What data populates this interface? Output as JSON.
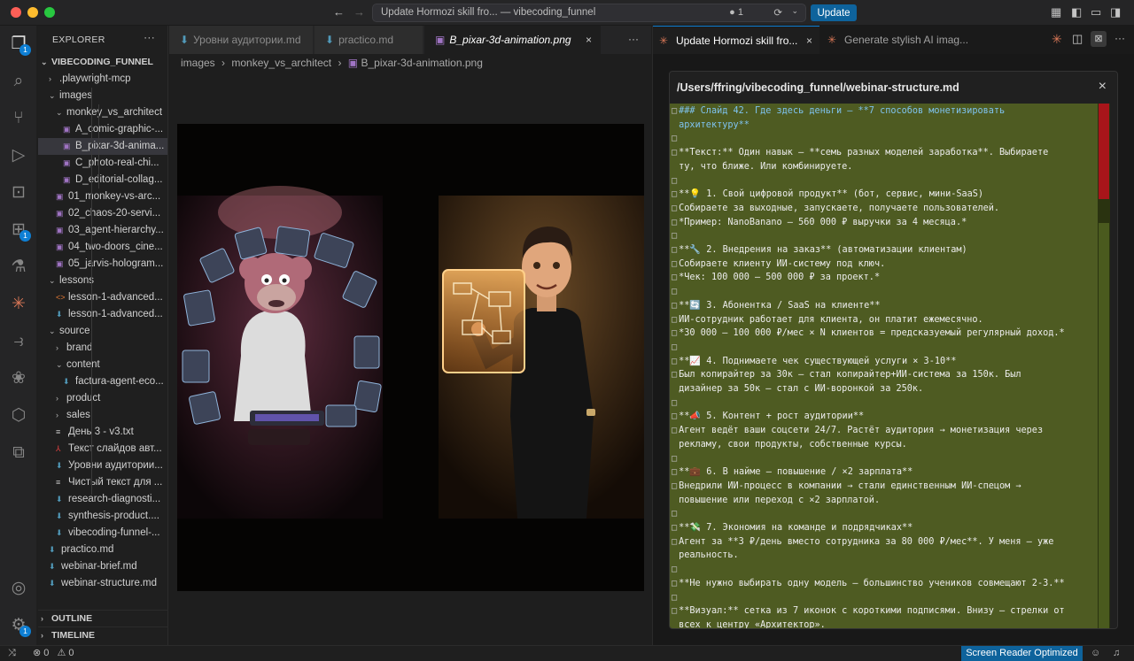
{
  "titlebar": {
    "command_center": "Update Hormozi skill fro... — vibecoding_funnel",
    "notifications_count": "1",
    "update_label": "Update"
  },
  "activity_bar": {
    "explorer_badge": "1",
    "extensions_badge": "1",
    "accounts_badge": "1"
  },
  "explorer": {
    "header": "EXPLORER",
    "project": "VIBECODING_FUNNEL",
    "items": [
      {
        "name": ".playwright-mcp",
        "kind": "folder",
        "open": false,
        "depth": 1
      },
      {
        "name": "images",
        "kind": "folder",
        "open": true,
        "depth": 1
      },
      {
        "name": "monkey_vs_architect",
        "kind": "folder",
        "open": true,
        "depth": 2
      },
      {
        "name": "A_comic-graphic-...",
        "kind": "image",
        "depth": 3
      },
      {
        "name": "B_pixar-3d-anima...",
        "kind": "image",
        "depth": 3,
        "selected": true
      },
      {
        "name": "C_photo-real-chi...",
        "kind": "image",
        "depth": 3
      },
      {
        "name": "D_editorial-collag...",
        "kind": "image",
        "depth": 3
      },
      {
        "name": "01_monkey-vs-arc...",
        "kind": "image",
        "depth": 2
      },
      {
        "name": "02_chaos-20-servi...",
        "kind": "image",
        "depth": 2
      },
      {
        "name": "03_agent-hierarchy...",
        "kind": "image",
        "depth": 2
      },
      {
        "name": "04_two-doors_cine...",
        "kind": "image",
        "depth": 2
      },
      {
        "name": "05_jarvis-hologram...",
        "kind": "image",
        "depth": 2
      },
      {
        "name": "lessons",
        "kind": "folder",
        "open": true,
        "depth": 1
      },
      {
        "name": "lesson-1-advanced...",
        "kind": "html",
        "depth": 2
      },
      {
        "name": "lesson-1-advanced...",
        "kind": "md",
        "depth": 2
      },
      {
        "name": "source",
        "kind": "folder",
        "open": true,
        "depth": 1
      },
      {
        "name": "brand",
        "kind": "folder",
        "open": false,
        "depth": 2
      },
      {
        "name": "content",
        "kind": "folder",
        "open": true,
        "depth": 2
      },
      {
        "name": "factura-agent-eco...",
        "kind": "md",
        "depth": 3
      },
      {
        "name": "product",
        "kind": "folder",
        "open": false,
        "depth": 2
      },
      {
        "name": "sales",
        "kind": "folder",
        "open": false,
        "depth": 2
      },
      {
        "name": "День 3 - v3.txt",
        "kind": "txt",
        "depth": 2
      },
      {
        "name": "Текст слайдов авт...",
        "kind": "pdf",
        "depth": 2
      },
      {
        "name": "Уровни аудитории...",
        "kind": "md",
        "depth": 2
      },
      {
        "name": "Чистый текст для ...",
        "kind": "txt",
        "depth": 2
      },
      {
        "name": "research-diagnosti...",
        "kind": "md",
        "depth": 2
      },
      {
        "name": "synthesis-product....",
        "kind": "md",
        "depth": 2
      },
      {
        "name": "vibecoding-funnel-...",
        "kind": "md",
        "depth": 2
      },
      {
        "name": "practico.md",
        "kind": "md",
        "depth": 1
      },
      {
        "name": "webinar-brief.md",
        "kind": "md",
        "depth": 1
      },
      {
        "name": "webinar-structure.md",
        "kind": "md",
        "depth": 1
      }
    ],
    "outline": "OUTLINE",
    "timeline": "TIMELINE"
  },
  "editor": {
    "tabs": [
      {
        "label": "Уровни аудитории.md",
        "active": false
      },
      {
        "label": "practico.md",
        "active": false
      },
      {
        "label": "B_pixar-3d-animation.png",
        "active": true
      }
    ],
    "breadcrumb": [
      "images",
      "monkey_vs_architect",
      "B_pixar-3d-animation.png"
    ]
  },
  "chat": {
    "tabs": [
      {
        "label": "Update Hormozi skill fro...",
        "active": true
      },
      {
        "label": "Generate stylish AI imag...",
        "active": false
      }
    ],
    "file_path": "/Users/ffring/vibecoding_funnel/webinar-structure.md",
    "lines": [
      {
        "t": "### Слайд 42. Где здесь деньги — **7 способов монетизировать",
        "h": true
      },
      {
        "t": "архитектуру**",
        "h": true,
        "nog": true
      },
      {
        "t": ""
      },
      {
        "t": "**Текст:** Один навык — **семь разных моделей заработка**. Выбираете"
      },
      {
        "t": "ту, что ближе. Или комбинируете.",
        "nog": true
      },
      {
        "t": ""
      },
      {
        "t": "**💡 1. Свой цифровой продукт** (бот, сервис, мини-SaaS)"
      },
      {
        "t": "Собираете за выходные, запускаете, получаете пользователей."
      },
      {
        "t": "*Пример: NanoBanano — 560 000 ₽ выручки за 4 месяца.*"
      },
      {
        "t": ""
      },
      {
        "t": "**🔧 2. Внедрения на заказ** (автоматизации клиентам)"
      },
      {
        "t": "Собираете клиенту ИИ-систему под ключ."
      },
      {
        "t": "*Чек: 100 000 — 500 000 ₽ за проект.*"
      },
      {
        "t": ""
      },
      {
        "t": "**🔄 3. Абонентка / SaaS на клиенте**"
      },
      {
        "t": "ИИ-сотрудник работает для клиента, он платит ежемесячно."
      },
      {
        "t": "*30 000 — 100 000 ₽/мес × N клиентов = предсказуемый регулярный доход.*"
      },
      {
        "t": ""
      },
      {
        "t": "**📈 4. Поднимаете чек существующей услуги × 3-10**"
      },
      {
        "t": "Был копирайтер за 30к — стал копирайтер+ИИ-система за 150к. Был"
      },
      {
        "t": "дизайнер за 50к — стал с ИИ-воронкой за 250к.",
        "nog": true
      },
      {
        "t": ""
      },
      {
        "t": "**📣 5. Контент + рост аудитории**"
      },
      {
        "t": "Агент ведёт ваши соцсети 24/7. Растёт аудитория → монетизация через"
      },
      {
        "t": "рекламу, свои продукты, собственные курсы.",
        "nog": true
      },
      {
        "t": ""
      },
      {
        "t": "**💼 6. В найме — повышение / ×2 зарплата**"
      },
      {
        "t": "Внедрили ИИ-процесс в компании → стали единственным ИИ-спецом →"
      },
      {
        "t": "повышение или переход с ×2 зарплатой.",
        "nog": true
      },
      {
        "t": ""
      },
      {
        "t": "**💸 7. Экономия на команде и подрядчиках**"
      },
      {
        "t": "Агент за **3 ₽/день вместо сотрудника за 80 000 ₽/мес**. У меня — уже"
      },
      {
        "t": "реальность.",
        "nog": true
      },
      {
        "t": ""
      },
      {
        "t": "**Не нужно выбирать одну модель — большинство учеников совмещают 2-3.**"
      },
      {
        "t": ""
      },
      {
        "t": "**Визуал:** сетка из 7 иконок с короткими подписями. Внизу — стрелки от"
      },
      {
        "t": "всех к центру «Архитектор».",
        "nog": true
      }
    ]
  },
  "status": {
    "errors": "0",
    "warnings": "0",
    "screen_reader": "Screen Reader Optimized"
  },
  "colors": {
    "accent": "#0e639c",
    "code_bg": "#4e5b22",
    "heading": "#7fc3ef",
    "claude": "#d97757"
  }
}
